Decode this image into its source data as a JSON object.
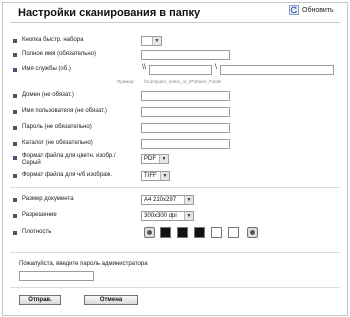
{
  "header": {
    "title": "Настройки сканирования в папку",
    "refresh_label": "Обновить"
  },
  "form": {
    "speed_dial_key": {
      "label": "Кнопка быстр. набора",
      "value": ""
    },
    "full_name": {
      "label": "Полное имя (обязательно)",
      "value": ""
    },
    "service_name": {
      "label": "Имя службы (об.)",
      "prefix": "\\\\",
      "separator": "\\",
      "host_value": "",
      "share_value": ""
    },
    "example": {
      "label": "Пример:",
      "text": "\\\\Computer_name_or_IP\\Share_Folder"
    },
    "domain": {
      "label": "Домен (не обязат.)",
      "value": ""
    },
    "user_name": {
      "label": "Имя пользователя (не обязат.)",
      "value": ""
    },
    "password": {
      "label": "Пароль (не обязательно)",
      "value": ""
    },
    "directory": {
      "label": "Каталог (не обязательно)",
      "value": ""
    },
    "color_gray_format": {
      "label": "Формат файла для цветн. изобр./Серый",
      "value": "PDF"
    },
    "bw_format": {
      "label": "Формат файла для ч/б изображ.",
      "value": "TIFF"
    },
    "document_size": {
      "label": "Размер документа",
      "value": "A4 210x297"
    },
    "resolution": {
      "label": "Разрешение",
      "value": "300x300 dpi"
    },
    "density": {
      "label": "Плотность",
      "levels": 5,
      "selected_index": 2,
      "colors": {
        "dark": "#111111",
        "light": "#ffffff"
      }
    }
  },
  "admin": {
    "password_prompt": "Пожалуйста, введите пароль администратора",
    "password_value": ""
  },
  "buttons": {
    "submit_label": "Отправ.",
    "cancel_label": "Отмена"
  },
  "colors": {
    "bullet": "#44576e",
    "border": "#9d9d9d"
  },
  "icons": {
    "refresh": "refresh-icon",
    "dropdown": "chevron-down-icon",
    "density_decrease": "density-decrease-icon",
    "density_increase": "density-increase-icon"
  }
}
